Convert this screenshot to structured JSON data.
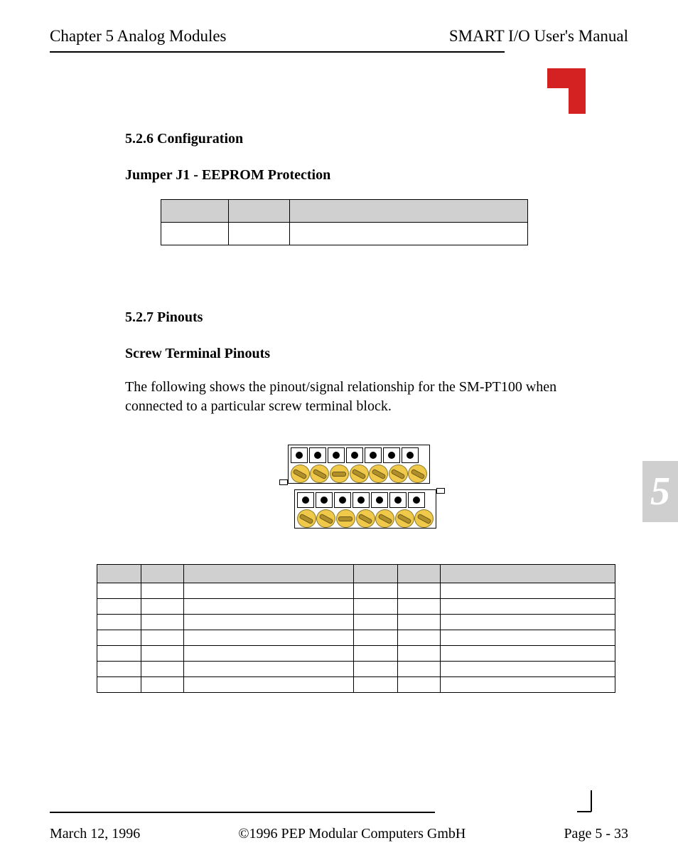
{
  "header": {
    "left": "Chapter 5  Analog Modules",
    "right": "SMART I/O User's Manual"
  },
  "section_5_2_6": {
    "heading": "5.2.6 Configuration",
    "subheading": "Jumper J1 - EEPROM Protection"
  },
  "section_5_2_7": {
    "heading": "5.2.7 Pinouts",
    "subheading": "Screw Terminal Pinouts",
    "paragraph": "The following shows the pinout/signal relationship for the SM-PT100 when connected to a particular screw terminal block."
  },
  "side_tab": "5",
  "footer": {
    "date": "March 12, 1996",
    "copyright": "©1996 PEP Modular Computers GmbH",
    "page": "Page 5 - 33"
  }
}
